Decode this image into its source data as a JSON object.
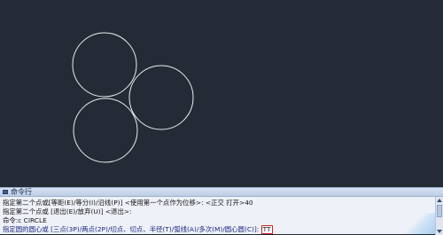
{
  "canvas": {
    "background": "#252b36",
    "circle_stroke": "#e9ecef",
    "circle_count": 3
  },
  "command_window": {
    "title": "命令行",
    "icon": "command-window-icon",
    "lines": [
      "指定第二个点或[等距(E)/等分(I)/沿线(P)] <使用第一个点作为位移>: <正交 打开>40",
      "指定第二个点或 [退出(E)/放弃(U)] <退出>:",
      "命令:c CIRCLE"
    ],
    "input_prompt": "指定圆的圆心或 [三点(3P)/两点(2P)/切点、切点、半径(T)/弧线(A)/多次(M)/圆心圆(C)]: ",
    "input_value": "TT",
    "highlight_color": "#d21f1f"
  }
}
